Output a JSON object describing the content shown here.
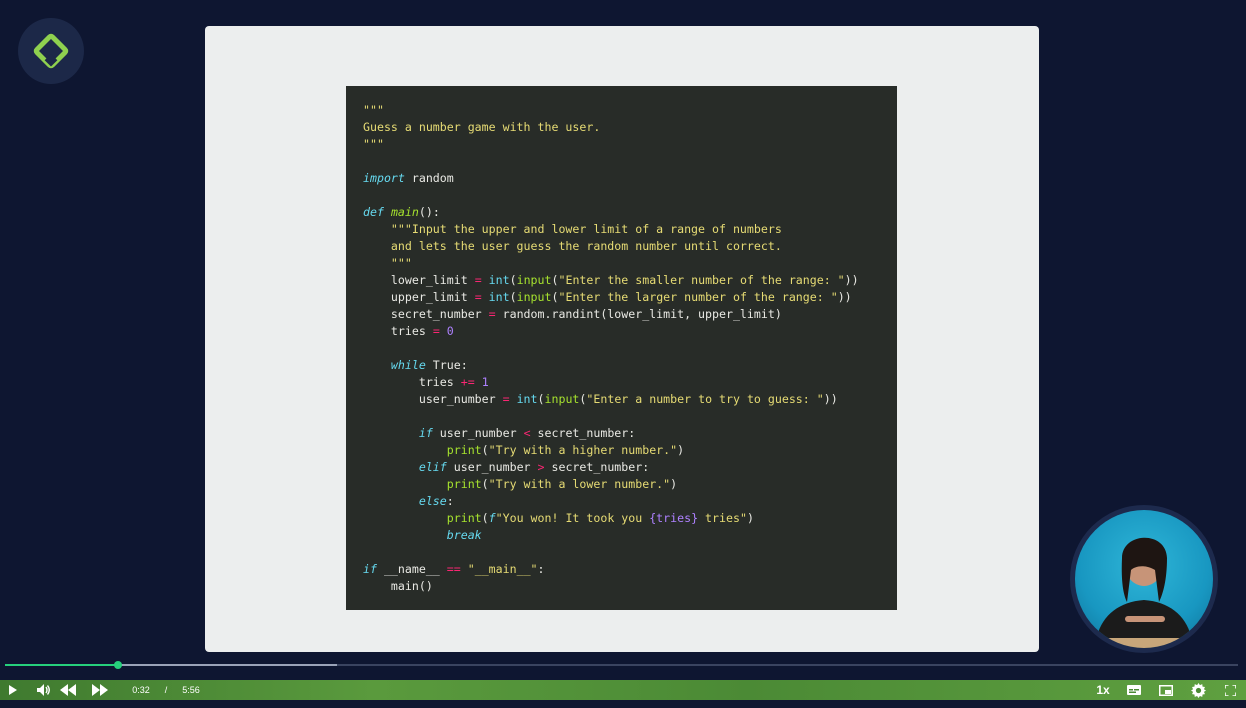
{
  "code": [
    [
      {
        "t": "\"\"\"",
        "c": "str"
      }
    ],
    [
      {
        "t": "Guess a number game with the user.",
        "c": "str"
      }
    ],
    [
      {
        "t": "\"\"\"",
        "c": "str"
      }
    ],
    [],
    [
      {
        "t": "import",
        "c": "kw"
      },
      {
        "t": " random",
        "c": "plain"
      }
    ],
    [],
    [
      {
        "t": "def",
        "c": "kw"
      },
      {
        "t": " ",
        "c": "plain"
      },
      {
        "t": "main",
        "c": "fn"
      },
      {
        "t": "():",
        "c": "plain"
      }
    ],
    [
      {
        "t": "    \"\"\"Input the upper and lower limit of a range of numbers",
        "c": "str"
      }
    ],
    [
      {
        "t": "    and lets the user guess the random number until correct.",
        "c": "str"
      }
    ],
    [
      {
        "t": "    \"\"\"",
        "c": "str"
      }
    ],
    [
      {
        "t": "    lower_limit ",
        "c": "plain"
      },
      {
        "t": "=",
        "c": "op"
      },
      {
        "t": " ",
        "c": "plain"
      },
      {
        "t": "int",
        "c": "kw2"
      },
      {
        "t": "(",
        "c": "plain"
      },
      {
        "t": "input",
        "c": "fn2"
      },
      {
        "t": "(",
        "c": "plain"
      },
      {
        "t": "\"Enter the smaller number of the range: \"",
        "c": "str"
      },
      {
        "t": "))",
        "c": "plain"
      }
    ],
    [
      {
        "t": "    upper_limit ",
        "c": "plain"
      },
      {
        "t": "=",
        "c": "op"
      },
      {
        "t": " ",
        "c": "plain"
      },
      {
        "t": "int",
        "c": "kw2"
      },
      {
        "t": "(",
        "c": "plain"
      },
      {
        "t": "input",
        "c": "fn2"
      },
      {
        "t": "(",
        "c": "plain"
      },
      {
        "t": "\"Enter the larger number of the range: \"",
        "c": "str"
      },
      {
        "t": "))",
        "c": "plain"
      }
    ],
    [
      {
        "t": "    secret_number ",
        "c": "plain"
      },
      {
        "t": "=",
        "c": "op"
      },
      {
        "t": " random.randint(lower_limit, upper_limit)",
        "c": "plain"
      }
    ],
    [
      {
        "t": "    tries ",
        "c": "plain"
      },
      {
        "t": "=",
        "c": "op"
      },
      {
        "t": " ",
        "c": "plain"
      },
      {
        "t": "0",
        "c": "num"
      }
    ],
    [],
    [
      {
        "t": "    ",
        "c": "plain"
      },
      {
        "t": "while",
        "c": "kw"
      },
      {
        "t": " True:",
        "c": "plain"
      }
    ],
    [
      {
        "t": "        tries ",
        "c": "plain"
      },
      {
        "t": "+=",
        "c": "op"
      },
      {
        "t": " ",
        "c": "plain"
      },
      {
        "t": "1",
        "c": "num"
      }
    ],
    [
      {
        "t": "        user_number ",
        "c": "plain"
      },
      {
        "t": "=",
        "c": "op"
      },
      {
        "t": " ",
        "c": "plain"
      },
      {
        "t": "int",
        "c": "kw2"
      },
      {
        "t": "(",
        "c": "plain"
      },
      {
        "t": "input",
        "c": "fn2"
      },
      {
        "t": "(",
        "c": "plain"
      },
      {
        "t": "\"Enter a number to try to guess: \"",
        "c": "str"
      },
      {
        "t": "))",
        "c": "plain"
      }
    ],
    [],
    [
      {
        "t": "        ",
        "c": "plain"
      },
      {
        "t": "if",
        "c": "kw"
      },
      {
        "t": " user_number ",
        "c": "plain"
      },
      {
        "t": "<",
        "c": "op"
      },
      {
        "t": " secret_number:",
        "c": "plain"
      }
    ],
    [
      {
        "t": "            ",
        "c": "plain"
      },
      {
        "t": "print",
        "c": "fn2"
      },
      {
        "t": "(",
        "c": "plain"
      },
      {
        "t": "\"Try with a higher number.\"",
        "c": "str"
      },
      {
        "t": ")",
        "c": "plain"
      }
    ],
    [
      {
        "t": "        ",
        "c": "plain"
      },
      {
        "t": "elif",
        "c": "kw"
      },
      {
        "t": " user_number ",
        "c": "plain"
      },
      {
        "t": ">",
        "c": "op"
      },
      {
        "t": " secret_number:",
        "c": "plain"
      }
    ],
    [
      {
        "t": "            ",
        "c": "plain"
      },
      {
        "t": "print",
        "c": "fn2"
      },
      {
        "t": "(",
        "c": "plain"
      },
      {
        "t": "\"Try with a lower number.\"",
        "c": "str"
      },
      {
        "t": ")",
        "c": "plain"
      }
    ],
    [
      {
        "t": "        ",
        "c": "plain"
      },
      {
        "t": "else",
        "c": "kw"
      },
      {
        "t": ":",
        "c": "plain"
      }
    ],
    [
      {
        "t": "            ",
        "c": "plain"
      },
      {
        "t": "print",
        "c": "fn2"
      },
      {
        "t": "(",
        "c": "plain"
      },
      {
        "t": "f",
        "c": "kw"
      },
      {
        "t": "\"You won! It took you ",
        "c": "str"
      },
      {
        "t": "{tries}",
        "c": "str2"
      },
      {
        "t": " tries\"",
        "c": "str"
      },
      {
        "t": ")",
        "c": "plain"
      }
    ],
    [
      {
        "t": "            ",
        "c": "plain"
      },
      {
        "t": "break",
        "c": "kw"
      }
    ],
    [],
    [
      {
        "t": "if",
        "c": "kw"
      },
      {
        "t": " __name__ ",
        "c": "plain"
      },
      {
        "t": "==",
        "c": "op"
      },
      {
        "t": " ",
        "c": "plain"
      },
      {
        "t": "\"__main__\"",
        "c": "str"
      },
      {
        "t": ":",
        "c": "plain"
      }
    ],
    [
      {
        "t": "    main()",
        "c": "plain"
      }
    ]
  ],
  "player": {
    "current_time": "0:32",
    "separator": "/",
    "duration": "5:56",
    "speed": "1x",
    "progress": 0.092,
    "buffered": 0.269
  },
  "colors": {
    "accent": "#26d07c",
    "background": "#0e1631",
    "code_bg": "#282c28"
  }
}
